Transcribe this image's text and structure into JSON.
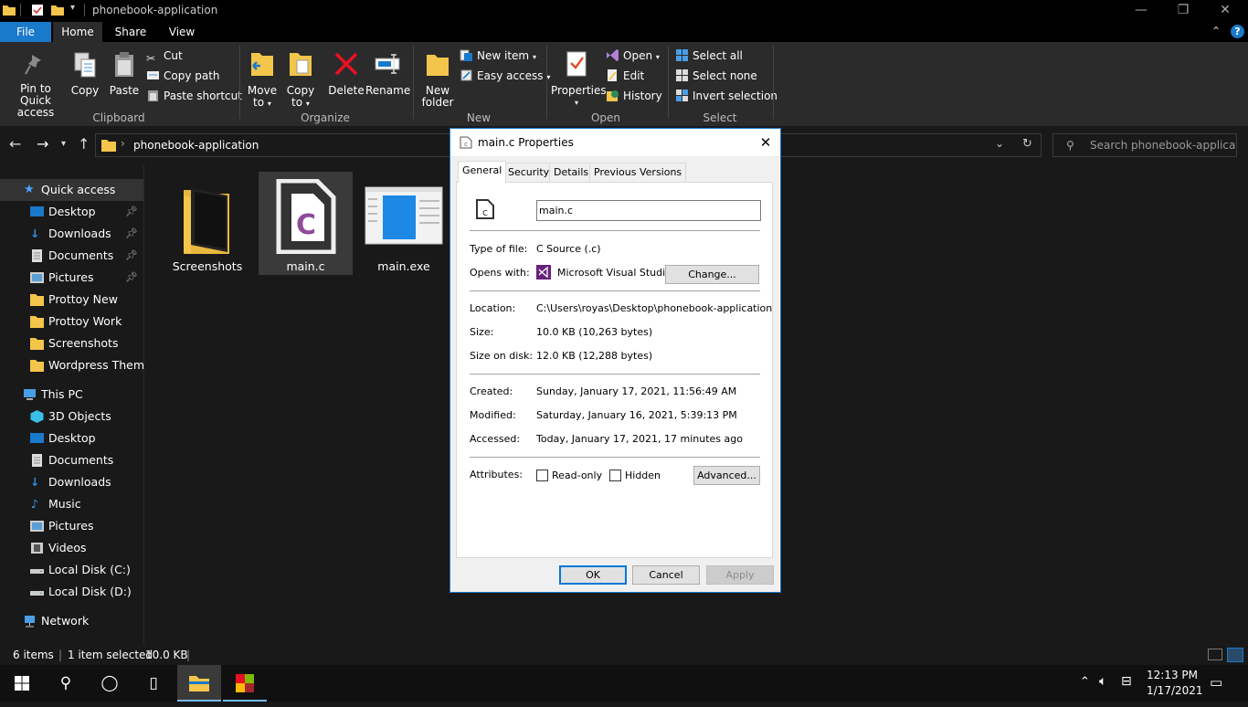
{
  "window": {
    "title": "phonebook-application",
    "controls": [
      "minimize",
      "restore",
      "close"
    ]
  },
  "ribbon_tabs": [
    "File",
    "Home",
    "Share",
    "View"
  ],
  "ribbon": {
    "clipboard": {
      "label": "Clipboard",
      "pin": "Pin to Quick access",
      "pin_l1": "Pin to Quick",
      "pin_l2": "access",
      "copy": "Copy",
      "paste": "Paste",
      "cut": "Cut",
      "copy_path": "Copy path",
      "paste_shortcut": "Paste shortcut"
    },
    "organize": {
      "label": "Organize",
      "move_l1": "Move",
      "move_l2": "to",
      "copy_l1": "Copy",
      "copy_l2": "to",
      "delete": "Delete",
      "rename": "Rename"
    },
    "new": {
      "label": "New",
      "folder_l1": "New",
      "folder_l2": "folder",
      "new_item": "New item",
      "easy_access": "Easy access"
    },
    "open": {
      "label": "Open",
      "properties": "Properties",
      "open": "Open",
      "edit": "Edit",
      "history": "History"
    },
    "select": {
      "label": "Select",
      "select_all": "Select all",
      "select_none": "Select none",
      "invert": "Invert selection"
    }
  },
  "address": {
    "path": "phonebook-application",
    "search_placeholder": "Search phonebook-applicati..."
  },
  "sidebar": {
    "quick_access": "Quick access",
    "qa_items": [
      {
        "label": "Desktop",
        "pinned": true
      },
      {
        "label": "Downloads",
        "pinned": true
      },
      {
        "label": "Documents",
        "pinned": true
      },
      {
        "label": "Pictures",
        "pinned": true
      },
      {
        "label": "Prottoy New",
        "pinned": false
      },
      {
        "label": "Prottoy Work",
        "pinned": false
      },
      {
        "label": "Screenshots",
        "pinned": false
      },
      {
        "label": "Wordpress Theme D",
        "pinned": false
      }
    ],
    "this_pc": "This PC",
    "pc_items": [
      "3D Objects",
      "Desktop",
      "Documents",
      "Downloads",
      "Music",
      "Pictures",
      "Videos",
      "Local Disk (C:)",
      "Local Disk (D:)"
    ],
    "network": "Network"
  },
  "files": [
    {
      "name": "Screenshots",
      "type": "folder"
    },
    {
      "name": "main.c",
      "type": "c-source",
      "selected": true
    },
    {
      "name": "main.exe",
      "type": "executable"
    }
  ],
  "status": {
    "items": "6 items",
    "selected": "1 item selected",
    "size": "10.0 KB"
  },
  "taskbar": {
    "time": "12:13 PM",
    "date": "1/17/2021"
  },
  "dialog": {
    "title": "main.c Properties",
    "tabs": [
      "General",
      "Security",
      "Details",
      "Previous Versions"
    ],
    "filename": "main.c",
    "type_label": "Type of file:",
    "type_value": "C Source (.c)",
    "opens_label": "Opens with:",
    "opens_value": "Microsoft Visual Studio .",
    "change": "Change...",
    "location_label": "Location:",
    "location_value": "C:\\Users\\royas\\Desktop\\phonebook-application",
    "size_label": "Size:",
    "size_value": "10.0 KB (10,263 bytes)",
    "disk_label": "Size on disk:",
    "disk_value": "12.0 KB (12,288 bytes)",
    "created_label": "Created:",
    "created_value": "Sunday, January 17, 2021, 11:56:49 AM",
    "modified_label": "Modified:",
    "modified_value": "Saturday, January 16, 2021, 5:39:13 PM",
    "accessed_label": "Accessed:",
    "accessed_value": "Today, January 17, 2021, 17 minutes ago",
    "attributes_label": "Attributes:",
    "readonly": "Read-only",
    "hidden": "Hidden",
    "advanced": "Advanced...",
    "ok": "OK",
    "cancel": "Cancel",
    "apply": "Apply"
  },
  "colors": {
    "accent": "#1979ca",
    "folder": "#f3c54a",
    "vs_purple": "#68217a",
    "c_purple": "#8e4b9a"
  }
}
